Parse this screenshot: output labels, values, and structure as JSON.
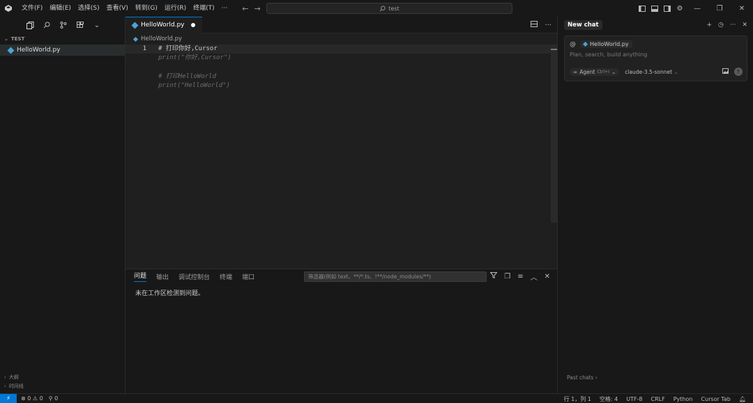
{
  "menu": [
    "文件(F)",
    "编辑(E)",
    "选择(S)",
    "查看(V)",
    "转到(G)",
    "运行(R)",
    "终端(T)"
  ],
  "menu_more": "···",
  "search": {
    "text": "test"
  },
  "sidebar": {
    "section": "TEST",
    "file": "HelloWorld.py",
    "bottom": [
      "大纲",
      "时间线"
    ]
  },
  "editor": {
    "tab_label": "HelloWorld.py",
    "breadcrumb": "HelloWorld.py",
    "lines": [
      {
        "num": "1",
        "text": "# 打印你好,Cursor"
      },
      {
        "num": "",
        "text": "print(\"你好,Cursor\")"
      },
      {
        "num": "",
        "text": ""
      },
      {
        "num": "",
        "text": "# 打印HelloWorld"
      },
      {
        "num": "",
        "text": "print(\"HelloWorld\")"
      }
    ]
  },
  "panel": {
    "tabs": [
      "问题",
      "输出",
      "调试控制台",
      "终端",
      "端口"
    ],
    "filter_placeholder": "筛选器(例如 text、**/*.ts、!**/node_modules/**)",
    "message": "未在工作区检测到问题。"
  },
  "chat": {
    "title": "New chat",
    "at": "@",
    "context_file": "HelloWorld.py",
    "placeholder": "Plan, search, build anything",
    "agent_label": "Agent",
    "agent_shortcut": "Ctrl+I",
    "model": "claude-3.5-sonnet",
    "past_chats": "Past chats"
  },
  "status": {
    "errors": "0",
    "warnings": "0",
    "ports": "0",
    "position": "行 1，列 1",
    "spaces": "空格: 4",
    "encoding": "UTF-8",
    "eol": "CRLF",
    "language": "Python",
    "cursor_tab": "Cursor Tab"
  },
  "colors": {
    "accent": "#0078d4",
    "python_icon": "#4aa3d8",
    "bg": "#181818",
    "editor_bg": "#1f1f1f"
  }
}
